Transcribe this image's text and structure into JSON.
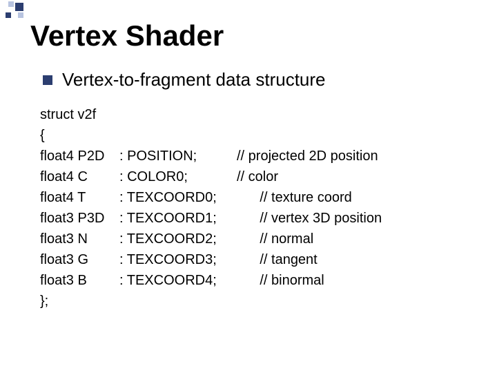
{
  "title": "Vertex Shader",
  "subtitle": "Vertex-to-fragment data structure",
  "struct_decl": "struct v2f",
  "open_brace": "{",
  "close_brace": "};",
  "fields": [
    {
      "decl": "float4 P2D",
      "sem": ": POSITION;",
      "cm": "// projected 2D position"
    },
    {
      "decl": "float4 C",
      "sem": ": COLOR0;",
      "cm": "// color"
    },
    {
      "decl": "float4 T",
      "sem": ": TEXCOORD0;",
      "cm": "      // texture coord"
    },
    {
      "decl": "float3 P3D",
      "sem": ": TEXCOORD1;",
      "cm": "      // vertex 3D position"
    },
    {
      "decl": "float3 N",
      "sem": ": TEXCOORD2;",
      "cm": "      // normal"
    },
    {
      "decl": "float3 G",
      "sem": ": TEXCOORD3;",
      "cm": "      // tangent"
    },
    {
      "decl": "float3 B",
      "sem": ": TEXCOORD4;",
      "cm": "      // binormal"
    }
  ]
}
